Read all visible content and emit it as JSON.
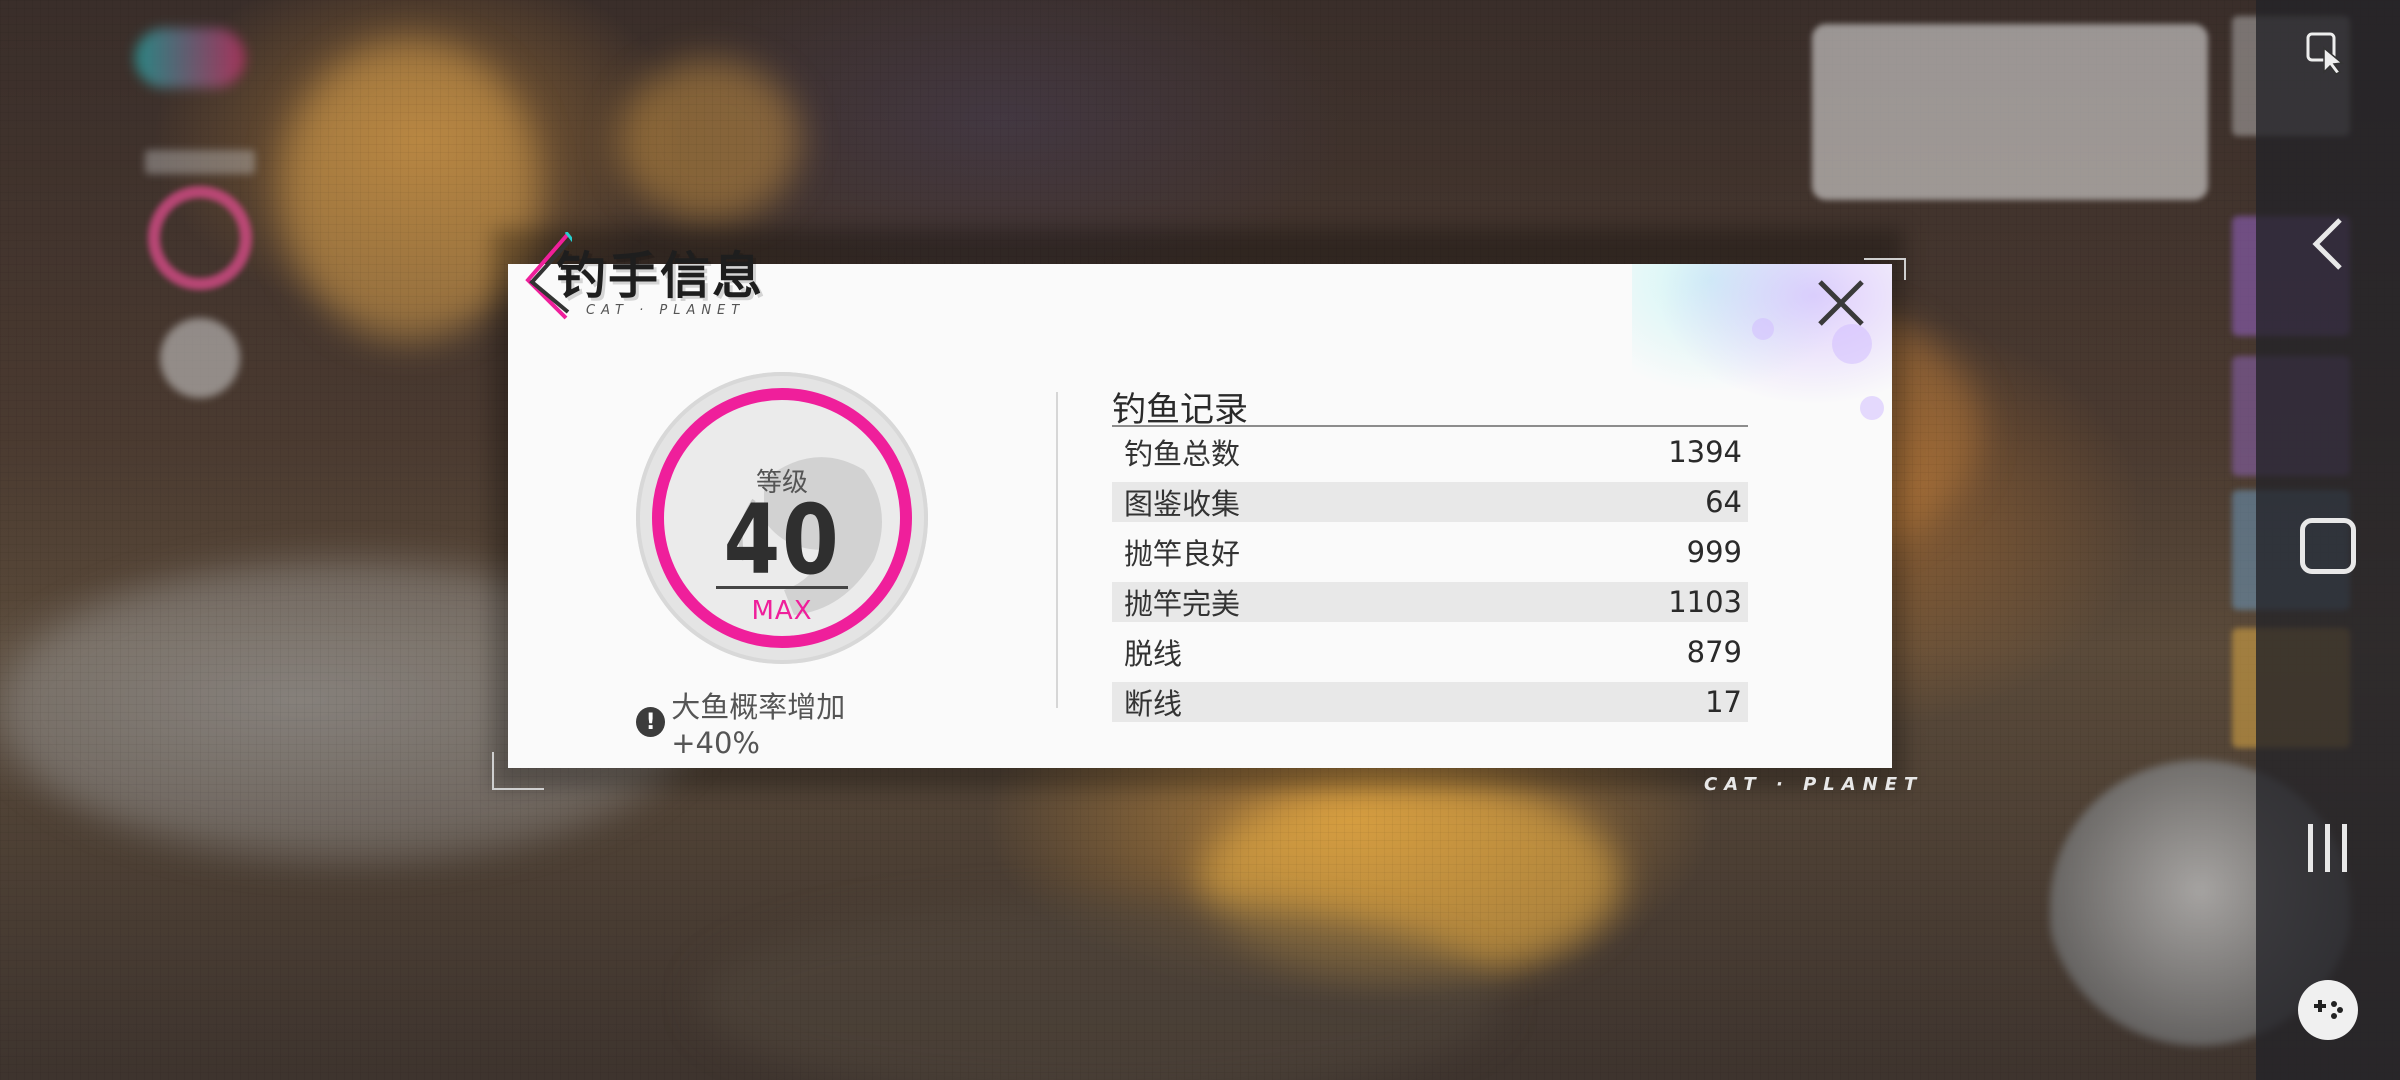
{
  "dialog": {
    "title": "钓手信息",
    "subtitle": "CAT · PLANET",
    "brand": "CAT · PLANET",
    "close_icon": "close-icon"
  },
  "level": {
    "label": "等级",
    "value": "40",
    "max_label": "MAX",
    "ring_color": "#ef1f9b"
  },
  "bonus": {
    "icon": "exclamation-icon",
    "text": "大鱼概率增加 +40%"
  },
  "records": {
    "title": "钓鱼记录",
    "rows": [
      {
        "label": "钓鱼总数",
        "value": "1394"
      },
      {
        "label": "图鉴收集",
        "value": "64"
      },
      {
        "label": "抛竿良好",
        "value": "999"
      },
      {
        "label": "抛竿完美",
        "value": "1103"
      },
      {
        "label": "脱线",
        "value": "879"
      },
      {
        "label": "断线",
        "value": "17"
      }
    ]
  },
  "nav": {
    "back_icon": "chevron-left-icon",
    "home_icon": "home-square-icon",
    "recents_icon": "recents-icon",
    "game_icon": "gamepad-icon",
    "cursor_icon": "pointer-icon"
  },
  "colors": {
    "accent": "#ef1f9b",
    "dialog_bg": "#fafafa",
    "row_shade": "#e8e8e8"
  }
}
